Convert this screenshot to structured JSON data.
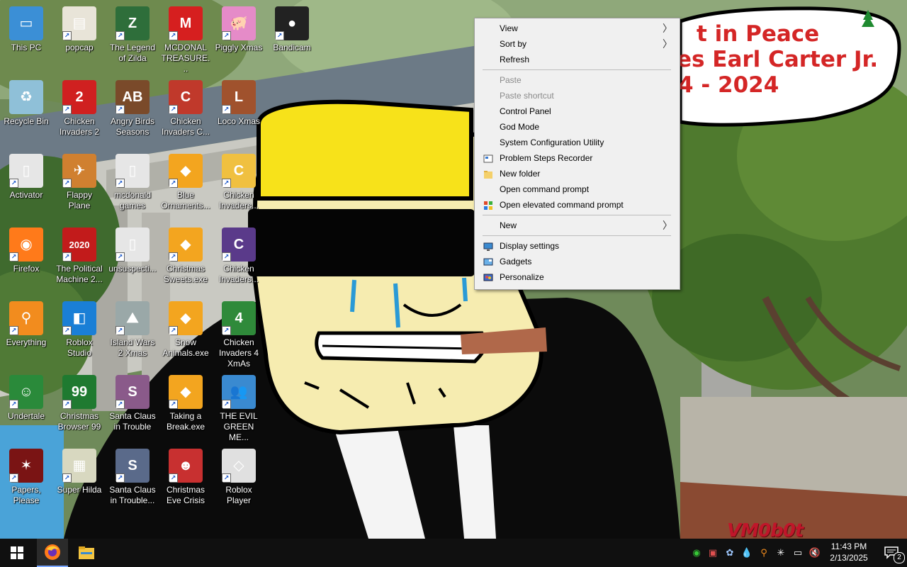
{
  "wallpaper": {
    "bubble_lines": [
      "t in Peace",
      "es Earl Carter Jr.",
      "4 - 2024"
    ],
    "watermark": "VM0b0t"
  },
  "desktop_icons": [
    {
      "label": "This PC",
      "icon": "computer-icon",
      "color": "#3b8fd6",
      "glyph": "▭"
    },
    {
      "label": "popcap",
      "icon": "folder-doc-icon",
      "color": "#e8e4d8",
      "glyph": "▤"
    },
    {
      "label": "The Legend of Zilda",
      "icon": "game-zilda-icon",
      "color": "#2e6e3a",
      "glyph": "Z"
    },
    {
      "label": "MCDONAL TREASURE...",
      "icon": "mcdonalds-icon",
      "color": "#d61f1f",
      "glyph": "M"
    },
    {
      "label": "Piggly Xmas",
      "icon": "pig-icon",
      "color": "#e58bc8",
      "glyph": "🐖"
    },
    {
      "label": "Bandicam",
      "icon": "record-icon",
      "color": "#222222",
      "glyph": "●"
    },
    {
      "label": "Recycle Bin",
      "icon": "recycle-bin-icon",
      "color": "#8fc0d8",
      "glyph": "♻"
    },
    {
      "label": "Chicken Invaders 2",
      "icon": "chicken-icon",
      "color": "#d02020",
      "glyph": "2"
    },
    {
      "label": "Angry Birds Seasons",
      "icon": "angry-birds-icon",
      "color": "#7a4a2a",
      "glyph": "AB"
    },
    {
      "label": "Chicken Invaders C...",
      "icon": "chicken-icon",
      "color": "#c0392b",
      "glyph": "C"
    },
    {
      "label": "Loco Xmas",
      "icon": "bear-icon",
      "color": "#a0522d",
      "glyph": "L"
    },
    {
      "label": "Activator",
      "icon": "file-icon",
      "color": "#e6e6e6",
      "glyph": "▯"
    },
    {
      "label": "Flappy Plane",
      "icon": "plane-icon",
      "color": "#d08030",
      "glyph": "✈"
    },
    {
      "label": "mcdonald games",
      "icon": "folder-doc-icon",
      "color": "#e6e6e6",
      "glyph": "▯"
    },
    {
      "label": "Blue Ornaments...",
      "icon": "popcap-icon",
      "color": "#f3a51f",
      "glyph": "◆"
    },
    {
      "label": "Chicken Invaders...",
      "icon": "chicken-icon",
      "color": "#f0c040",
      "glyph": "C"
    },
    {
      "label": "Firefox",
      "icon": "firefox-icon",
      "color": "#ff7a1a",
      "glyph": "◉"
    },
    {
      "label": "The Political Machine 2...",
      "icon": "political-icon",
      "color": "#c21b1b",
      "glyph": "2020"
    },
    {
      "label": "unsuspecti...",
      "icon": "file-icon",
      "color": "#e6e6e6",
      "glyph": "▯"
    },
    {
      "label": "Christmas Sweets.exe",
      "icon": "popcap-icon",
      "color": "#f3a51f",
      "glyph": "◆"
    },
    {
      "label": "Chicken Invaders...",
      "icon": "chicken-icon",
      "color": "#5a3a8a",
      "glyph": "C"
    },
    {
      "label": "Everything",
      "icon": "search-icon",
      "color": "#f28c1e",
      "glyph": "⚲"
    },
    {
      "label": "Roblox Studio",
      "icon": "roblox-studio-icon",
      "color": "#1a7fd6",
      "glyph": "◧"
    },
    {
      "label": "Island Wars 2 Xmas",
      "icon": "island-icon",
      "color": "#9aa8a8",
      "glyph": "⛰"
    },
    {
      "label": "Snow Animals.exe",
      "icon": "popcap-icon",
      "color": "#f3a51f",
      "glyph": "◆"
    },
    {
      "label": "Chicken Invaders 4 XmAs",
      "icon": "chicken-icon",
      "color": "#2f8a3a",
      "glyph": "4"
    },
    {
      "label": "Undertale",
      "icon": "undertale-icon",
      "color": "#2a8a3a",
      "glyph": "☺"
    },
    {
      "label": "Christmas Browser 99",
      "icon": "tree-icon",
      "color": "#1f7a30",
      "glyph": "99"
    },
    {
      "label": "Santa Claus in Trouble",
      "icon": "santa-icon",
      "color": "#8a5a8a",
      "glyph": "S"
    },
    {
      "label": "Taking a Break.exe",
      "icon": "popcap-icon",
      "color": "#f3a51f",
      "glyph": "◆"
    },
    {
      "label": "THE EVIL GREEN ME...",
      "icon": "messenger-icon",
      "color": "#3a8ad0",
      "glyph": "👥"
    },
    {
      "label": "Papers, Please",
      "icon": "papers-please-icon",
      "color": "#7a1414",
      "glyph": "✶"
    },
    {
      "label": "Super Hilda",
      "icon": "pixel-dog-icon",
      "color": "#d8d8c0",
      "glyph": "▦"
    },
    {
      "label": "Santa Claus in Trouble...",
      "icon": "santa-icon",
      "color": "#5a6a8a",
      "glyph": "S"
    },
    {
      "label": "Christmas Eve Crisis",
      "icon": "santa-face-icon",
      "color": "#c83030",
      "glyph": "☻"
    },
    {
      "label": "Roblox Player",
      "icon": "roblox-icon",
      "color": "#e0e0e0",
      "glyph": "◇"
    }
  ],
  "context_menu": {
    "items": [
      {
        "type": "item",
        "label": "View",
        "submenu": true,
        "icon": null,
        "disabled": false
      },
      {
        "type": "item",
        "label": "Sort by",
        "submenu": true,
        "icon": null,
        "disabled": false
      },
      {
        "type": "item",
        "label": "Refresh",
        "submenu": false,
        "icon": null,
        "disabled": false
      },
      {
        "type": "separator"
      },
      {
        "type": "item",
        "label": "Paste",
        "submenu": false,
        "icon": null,
        "disabled": true
      },
      {
        "type": "item",
        "label": "Paste shortcut",
        "submenu": false,
        "icon": null,
        "disabled": true
      },
      {
        "type": "item",
        "label": "Control Panel",
        "submenu": false,
        "icon": null,
        "disabled": false
      },
      {
        "type": "item",
        "label": "God Mode",
        "submenu": false,
        "icon": null,
        "disabled": false
      },
      {
        "type": "item",
        "label": "System Configuration Utility",
        "submenu": false,
        "icon": null,
        "disabled": false
      },
      {
        "type": "item",
        "label": "Problem Steps Recorder",
        "submenu": false,
        "icon": "steps-recorder-icon",
        "disabled": false
      },
      {
        "type": "item",
        "label": "New folder",
        "submenu": false,
        "icon": "folder-icon",
        "disabled": false
      },
      {
        "type": "item",
        "label": "Open command prompt",
        "submenu": false,
        "icon": null,
        "disabled": false
      },
      {
        "type": "item",
        "label": "Open elevated command prompt",
        "submenu": false,
        "icon": "windows-flag-icon",
        "disabled": false
      },
      {
        "type": "separator"
      },
      {
        "type": "item",
        "label": "New",
        "submenu": true,
        "icon": null,
        "disabled": false
      },
      {
        "type": "separator"
      },
      {
        "type": "item",
        "label": "Display settings",
        "submenu": false,
        "icon": "display-icon",
        "disabled": false
      },
      {
        "type": "item",
        "label": "Gadgets",
        "submenu": false,
        "icon": "gadgets-icon",
        "disabled": false
      },
      {
        "type": "item",
        "label": "Personalize",
        "submenu": false,
        "icon": "personalize-icon",
        "disabled": false
      }
    ],
    "submenu_glyph": "〉"
  },
  "taskbar": {
    "start_icon": "windows-start-icon",
    "pinned": [
      {
        "name": "firefox",
        "icon": "firefox-icon",
        "active": true
      },
      {
        "name": "file-explorer",
        "icon": "file-explorer-icon",
        "active": false
      }
    ],
    "tray": [
      {
        "icon": "green-circle-icon",
        "glyph": "◉",
        "color": "#37c837"
      },
      {
        "icon": "record-tray-icon",
        "glyph": "▣",
        "color": "#e05050"
      },
      {
        "icon": "tray-app-icon",
        "glyph": "✿",
        "color": "#9fc8ff"
      },
      {
        "icon": "drop-icon",
        "glyph": "💧",
        "color": "#e0e0e0"
      },
      {
        "icon": "everything-tray-icon",
        "glyph": "⚲",
        "color": "#f28c1e"
      },
      {
        "icon": "snowflake-icon",
        "glyph": "✳",
        "color": "#ffffff"
      },
      {
        "icon": "network-icon",
        "glyph": "▭",
        "color": "#ffffff"
      },
      {
        "icon": "volume-muted-icon",
        "glyph": "🔇",
        "color": "#ffffff"
      }
    ],
    "clock": {
      "time": "11:43 PM",
      "date": "2/13/2025"
    },
    "notifications": {
      "icon": "notifications-icon",
      "count": "2"
    }
  }
}
